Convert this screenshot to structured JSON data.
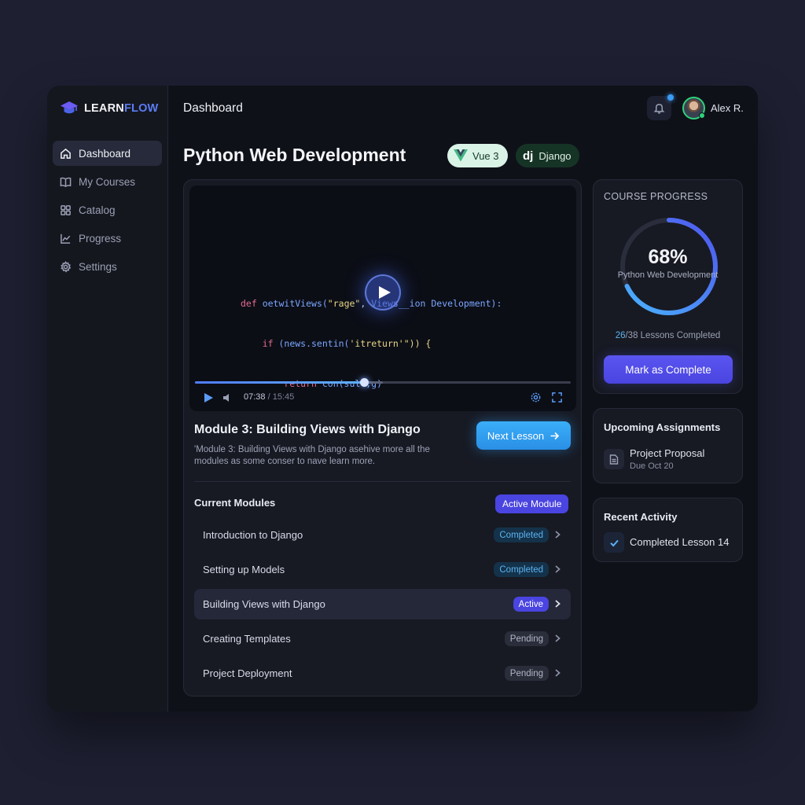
{
  "brand": {
    "name_part1": "LEARN",
    "name_part2": "FLOW"
  },
  "sidebar": {
    "items": [
      {
        "label": "Dashboard",
        "icon": "home-icon",
        "active": true
      },
      {
        "label": "My Courses",
        "icon": "book-icon",
        "active": false
      },
      {
        "label": "Catalog",
        "icon": "grid-icon",
        "active": false
      },
      {
        "label": "Progress",
        "icon": "chart-line-icon",
        "active": false
      },
      {
        "label": "Settings",
        "icon": "gear-icon",
        "active": false
      }
    ]
  },
  "header": {
    "title": "Dashboard",
    "user_name": "Alex R.",
    "notification_dot": true
  },
  "course": {
    "title": "Python Web Development",
    "tags": [
      "Vue 3",
      "Django"
    ],
    "tag_prefix_dj": "dj"
  },
  "video": {
    "code_lines": [
      [
        "def ",
        "oetwitViews(",
        "\"rage\"",
        ", ",
        "Views__ion Development):"
      ],
      [
        "    if ",
        "(news.sentin(",
        "'it",
        "",
        "return'\")) {"
      ],
      [
        "        return ",
        "con(sult,",
        "",
        "",
        "g)"
      ],
      [
        "    }",
        "",
        "",
        "",
        ""
      ]
    ],
    "current_time": "07:38",
    "time_separator": " / ",
    "duration": "15:45",
    "progress": 0.45,
    "buffered": 0.5
  },
  "module": {
    "title": "Module 3: Building Views with Django",
    "description": "'Module 3: Building Views with Django asehive more all the modules as some conser to nave learn more.",
    "next_button": "Next Lesson"
  },
  "current_modules": {
    "title": "Current Modules",
    "badge": "Active Module",
    "items": [
      {
        "name": "Introduction to Django",
        "status": "Completed",
        "status_type": "completed"
      },
      {
        "name": "Setting up Models",
        "status": "Completed",
        "status_type": "completed"
      },
      {
        "name": "Building Views with Django",
        "status": "Active",
        "status_type": "active"
      },
      {
        "name": "Creating Templates",
        "status": "Pending",
        "status_type": "pending"
      },
      {
        "name": "Project Deployment",
        "status": "Pending",
        "status_type": "pending"
      }
    ]
  },
  "course_progress": {
    "title": "COURSE PROGRESS",
    "percent_label": "68%",
    "percent": 0.68,
    "ring_label": "Python Web Development",
    "lessons_done": "26",
    "lessons_text": "/38 Lessons Completed",
    "button": "Mark as Complete"
  },
  "assignments": {
    "title": "Upcoming Assignments",
    "item_name": "Project Proposal",
    "item_due": "Due Oct 20"
  },
  "activity": {
    "title": "Recent Activity",
    "item": "Completed Lesson 14"
  },
  "colors": {
    "accent_blue": "#3aaef8",
    "accent_indigo": "#4a44e0",
    "completed_text": "#5cb3f0",
    "online_green": "#2ed17a"
  }
}
